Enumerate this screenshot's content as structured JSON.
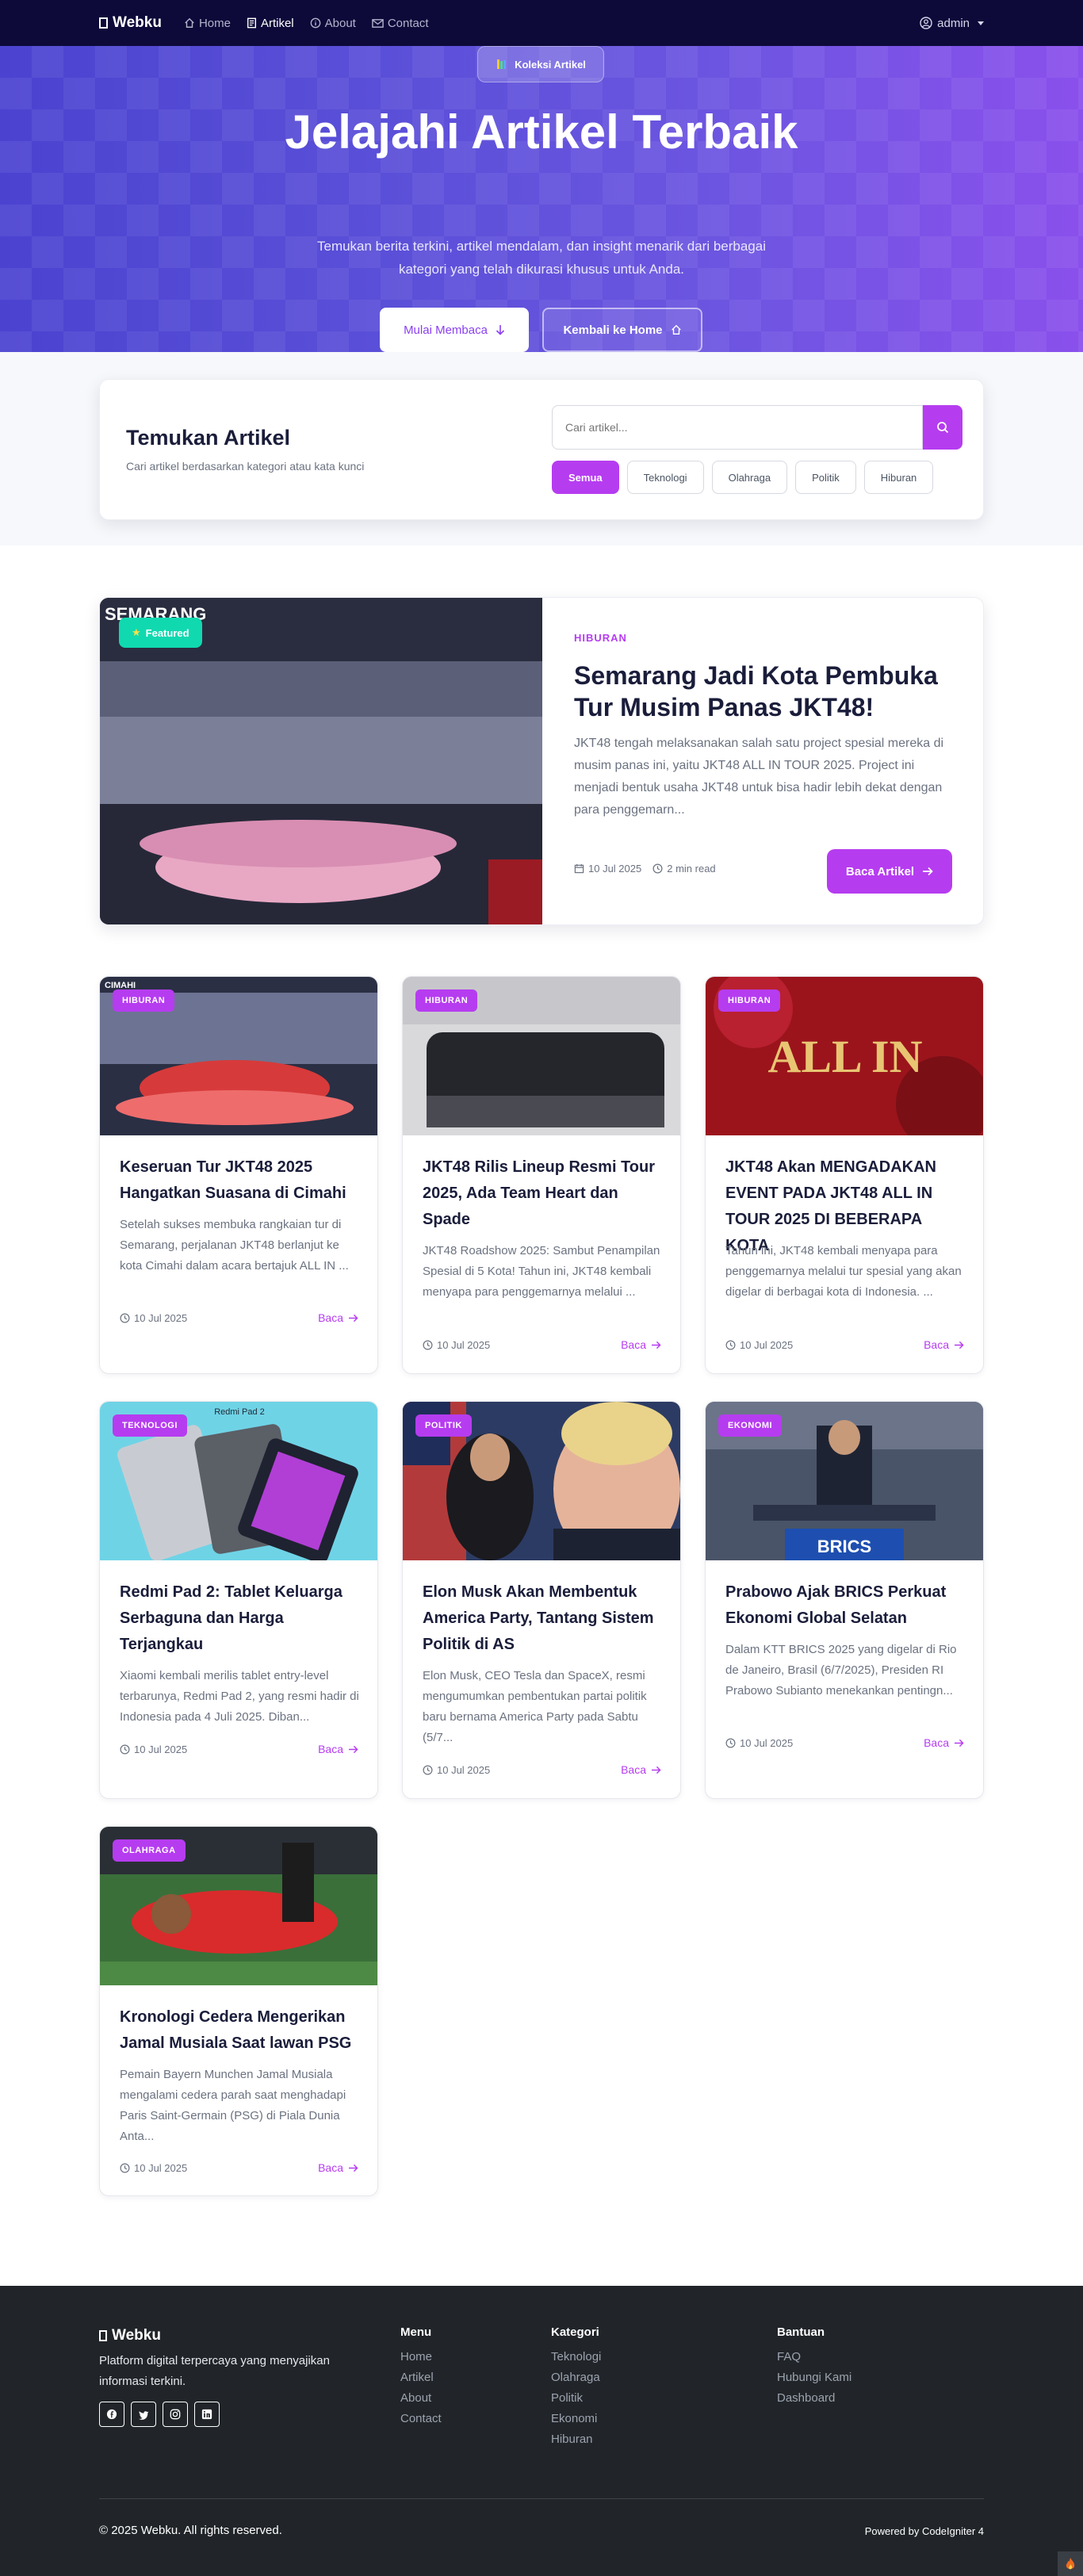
{
  "navbar": {
    "brand": "Webku",
    "links": [
      {
        "label": "Home",
        "icon": "home-icon"
      },
      {
        "label": "Artikel",
        "icon": "document-icon"
      },
      {
        "label": "About",
        "icon": "info-icon"
      },
      {
        "label": "Contact",
        "icon": "mail-icon"
      }
    ],
    "active_link": "Artikel",
    "user": "admin"
  },
  "hero": {
    "badge": "Koleksi Artikel",
    "title": "Jelajahi Artikel Terbaik",
    "subtitle": "Temukan berita terkini, artikel mendalam, dan insight menarik dari berbagai kategori yang telah dikurasi khusus untuk Anda.",
    "primary_button": "Mulai Membaca",
    "secondary_button": "Kembali ke Home"
  },
  "search": {
    "title": "Temukan Artikel",
    "description": "Cari artikel berdasarkan kategori atau kata kunci",
    "placeholder": "Cari artikel...",
    "filters": [
      "Semua",
      "Teknologi",
      "Olahraga",
      "Politik",
      "Hiburan"
    ],
    "active_filter": "Semua"
  },
  "featured": {
    "badge": "Featured",
    "image_text": "SEMARANG",
    "category": "HIBURAN",
    "title": "Semarang Jadi Kota Pembuka Tur Musim Panas JKT48!",
    "excerpt": "JKT48 tengah melaksanakan salah satu project spesial mereka di musim panas ini, yaitu JKT48 ALL IN TOUR 2025. Project ini menjadi bentuk usaha JKT48 untuk bisa hadir lebih dekat dengan para penggemarn...",
    "date": "10 Jul 2025",
    "read_time": "2 min read",
    "button": "Baca Artikel"
  },
  "articles": [
    {
      "category": "HIBURAN",
      "image_text": "CIMAHI",
      "title": "Keseruan Tur JKT48 2025 Hangatkan Suasana di Cimahi",
      "excerpt": "Setelah sukses membuka rangkaian tur di Semarang, perjalanan JKT48 berlanjut ke kota Cimahi dalam acara bertajuk ALL IN ...",
      "date": "10 Jul 2025",
      "read": "Baca"
    },
    {
      "category": "HIBURAN",
      "image_text": "",
      "title": "JKT48 Rilis Lineup Resmi Tour 2025, Ada Team Heart dan Spade",
      "excerpt": "JKT48 Roadshow 2025: Sambut Penampilan Spesial di 5 Kota! Tahun ini, JKT48 kembali menyapa para penggemarnya melalui ...",
      "date": "10 Jul 2025",
      "read": "Baca"
    },
    {
      "category": "HIBURAN",
      "image_text": "ALL IN",
      "title": "JKT48 Akan MENGADAKAN EVENT PADA JKT48 ALL IN TOUR 2025 DI BEBERAPA KOTA",
      "excerpt": "Tahun ini, JKT48 kembali menyapa para penggemarnya melalui tur spesial yang akan digelar di berbagai kota di Indonesia. ...",
      "date": "10 Jul 2025",
      "read": "Baca"
    },
    {
      "category": "TEKNOLOGI",
      "image_text": "Redmi Pad 2",
      "title": "Redmi Pad 2: Tablet Keluarga Serbaguna dan Harga Terjangkau",
      "excerpt": "Xiaomi kembali merilis tablet entry-level terbarunya, Redmi Pad 2, yang resmi hadir di Indonesia pada 4 Juli 2025. Diban...",
      "date": "10 Jul 2025",
      "read": "Baca"
    },
    {
      "category": "POLITIK",
      "image_text": "",
      "title": "Elon Musk Akan Membentuk America Party, Tantang Sistem Politik di AS",
      "excerpt": "Elon Musk, CEO Tesla dan SpaceX, resmi mengumumkan pembentukan partai politik baru bernama America Party pada Sabtu (5/7...",
      "date": "10 Jul 2025",
      "read": "Baca"
    },
    {
      "category": "EKONOMI",
      "image_text": "BRICS",
      "title": "Prabowo Ajak BRICS Perkuat Ekonomi Global Selatan",
      "excerpt": "Dalam KTT BRICS 2025 yang digelar di Rio de Janeiro, Brasil (6/7/2025), Presiden RI Prabowo Subianto menekankan pentingn...",
      "date": "10 Jul 2025",
      "read": "Baca"
    },
    {
      "category": "OLAHRAGA",
      "image_text": "",
      "title": "Kronologi Cedera Mengerikan Jamal Musiala Saat lawan PSG",
      "excerpt": "Pemain Bayern Munchen Jamal Musiala mengalami cedera parah saat menghadapi Paris Saint-Germain (PSG) di Piala Dunia Anta...",
      "date": "10 Jul 2025",
      "read": "Baca"
    }
  ],
  "footer": {
    "brand": "Webku",
    "description": "Platform digital terpercaya yang menyajikan informasi terkini.",
    "social_icons": [
      "facebook-icon",
      "twitter-icon",
      "instagram-icon",
      "linkedin-icon"
    ],
    "menu": {
      "title": "Menu",
      "links": [
        "Home",
        "Artikel",
        "About",
        "Contact"
      ]
    },
    "kategori": {
      "title": "Kategori",
      "links": [
        "Teknologi",
        "Olahraga",
        "Politik",
        "Ekonomi",
        "Hiburan"
      ]
    },
    "bantuan": {
      "title": "Bantuan",
      "links": [
        "FAQ",
        "Hubungi Kami",
        "Dashboard"
      ]
    },
    "copyright": "© 2025 Webku. All rights reserved.",
    "powered": "Powered by CodeIgniter 4"
  },
  "colors": {
    "accent": "#b63cf0",
    "navbar": "#0d0a3a",
    "footer": "#212529",
    "featured_badge": "#10d9b0"
  }
}
